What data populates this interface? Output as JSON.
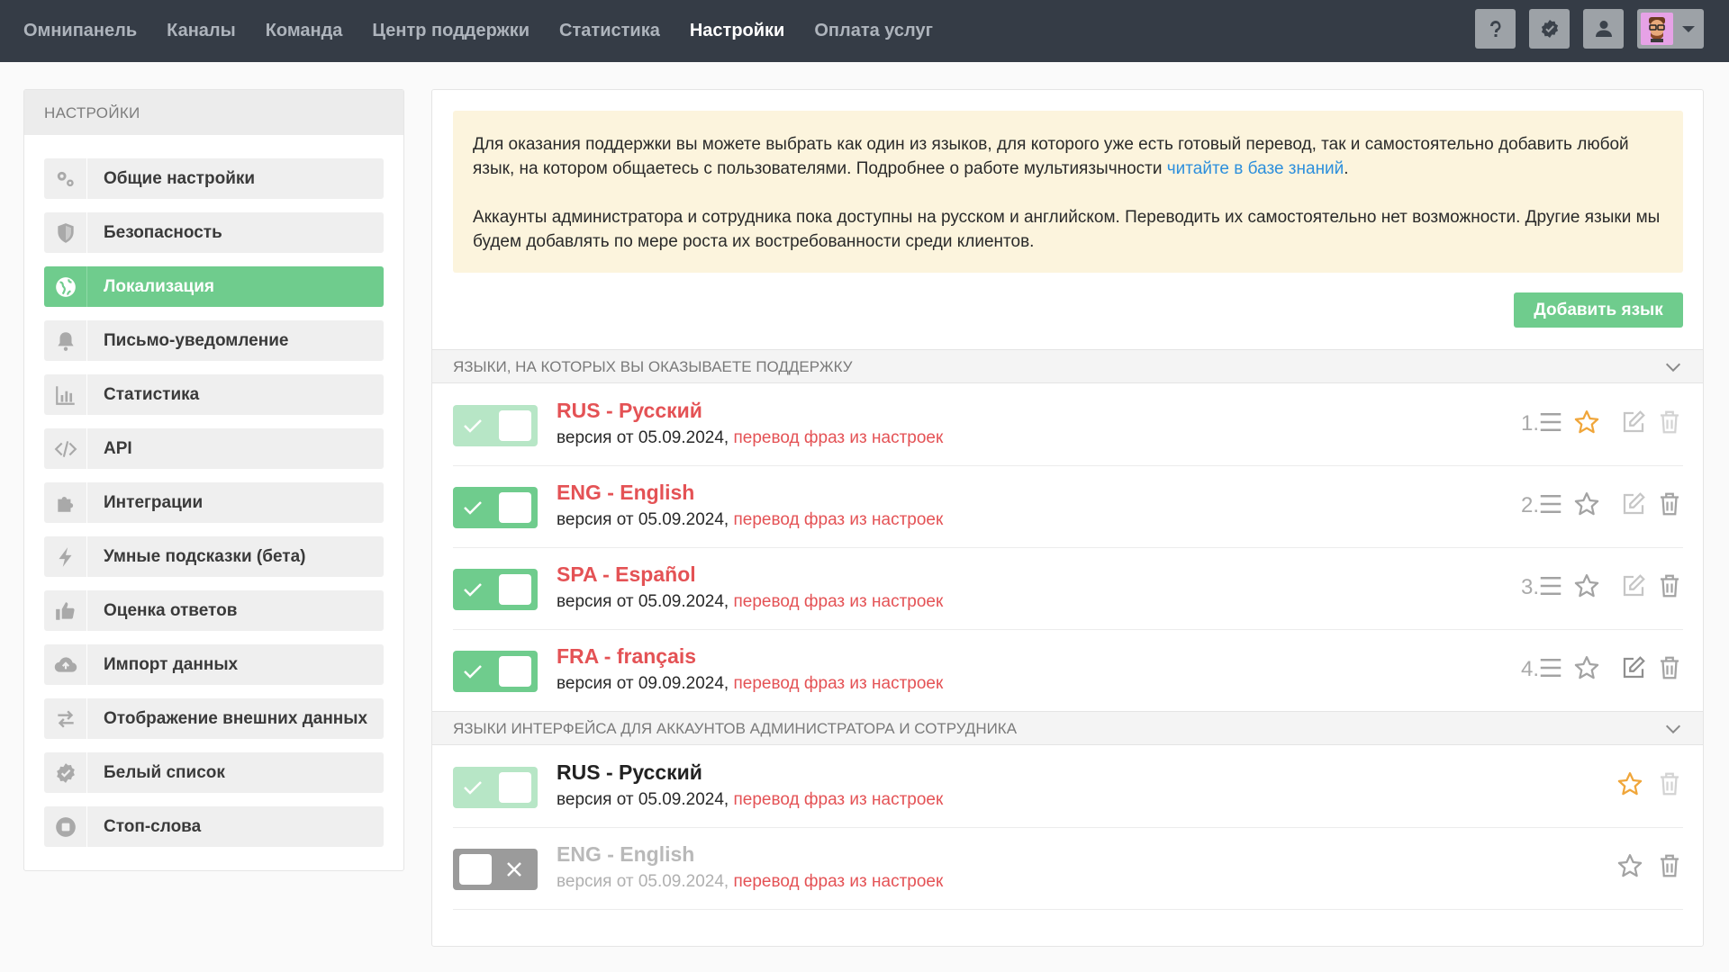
{
  "nav": {
    "items": [
      "Омнипанель",
      "Каналы",
      "Команда",
      "Центр поддержки",
      "Статистика",
      "Настройки",
      "Оплата услуг"
    ],
    "active": "Настройки"
  },
  "top_actions": [
    "help-icon",
    "badge-check-icon",
    "user-icon"
  ],
  "sidebar": {
    "title": "НАСТРОЙКИ",
    "items": [
      {
        "label": "Общие настройки",
        "icon": "gears-icon"
      },
      {
        "label": "Безопасность",
        "icon": "shield-icon"
      },
      {
        "label": "Локализация",
        "icon": "globe-icon",
        "active": true
      },
      {
        "label": "Письмо-уведомление",
        "icon": "bell-icon"
      },
      {
        "label": "Статистика",
        "icon": "bar-chart-icon"
      },
      {
        "label": "API",
        "icon": "code-icon"
      },
      {
        "label": "Интеграции",
        "icon": "puzzle-icon"
      },
      {
        "label": "Умные подсказки (бета)",
        "icon": "bolt-icon"
      },
      {
        "label": "Оценка ответов",
        "icon": "thumbs-up-icon"
      },
      {
        "label": "Импорт данных",
        "icon": "cloud-upload-icon"
      },
      {
        "label": "Отображение внешних данных",
        "icon": "exchange-icon"
      },
      {
        "label": "Белый список",
        "icon": "badge-check-icon"
      },
      {
        "label": "Стоп-слова",
        "icon": "stop-icon"
      }
    ]
  },
  "notice": {
    "p1_text": "Для оказания поддержки вы можете выбрать как один из языков, для которого уже есть готовый перевод, так и самостоятельно добавить любой язык, на котором общаетесь с пользователями. Подробнее о работе мультиязычности ",
    "p1_link": "читайте в базе знаний",
    "p1_end": ".",
    "p2": "Аккаунты администратора и сотрудника пока доступны на русском и английском. Переводить их самостоятельно нет возможности. Другие языки мы будем добавлять по мере роста их востребованности среди клиентов."
  },
  "add_button": "Добавить язык",
  "sections": {
    "support": "ЯЗЫКИ, НА КОТОРЫХ ВЫ ОКАЗЫВАЕТЕ ПОДДЕРЖКУ",
    "interface": "ЯЗЫКИ ИНТЕРФЕЙСА ДЛЯ АККАУНТОВ АДМИНИСТРАТОРА И СОТРУДНИКА"
  },
  "support_languages": [
    {
      "num": "1.",
      "title": "RUS - Русский",
      "version": "версия от 05.09.2024,",
      "link": "перевод фраз из настроек",
      "enabled": true,
      "locked": true,
      "default": true
    },
    {
      "num": "2.",
      "title": "ENG - English",
      "version": "версия от 05.09.2024,",
      "link": "перевод фраз из настроек",
      "enabled": true,
      "default": false
    },
    {
      "num": "3.",
      "title": "SPA - Español",
      "version": "версия от 05.09.2024,",
      "link": "перевод фраз из настроек",
      "enabled": true,
      "default": false
    },
    {
      "num": "4.",
      "title": "FRA - français",
      "version": "версия от 09.09.2024,",
      "link": "перевод фраз из настроек",
      "enabled": true,
      "default": false
    }
  ],
  "interface_languages": [
    {
      "title": "RUS - Русский",
      "version": "версия от 05.09.2024,",
      "link": "перевод фраз из настроек",
      "enabled": true,
      "locked": true,
      "default": true
    },
    {
      "title": "ENG - English",
      "version": "версия от 05.09.2024,",
      "link": "перевод фраз из настроек",
      "enabled": false,
      "default": false
    }
  ],
  "colors": {
    "topbar": "#353c46",
    "accent_green": "#6fcc8d",
    "language_red": "#e45255",
    "link_blue": "#2d8fdc",
    "star_gold": "#f0a63a",
    "notice_bg": "#fcf4dd"
  }
}
